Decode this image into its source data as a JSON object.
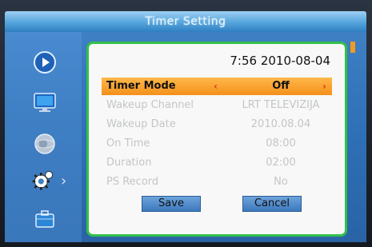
{
  "window": {
    "title": "Timer Setting"
  },
  "clock": "7:56 2010-08-04",
  "nav": [
    {
      "icon": "play-icon"
    },
    {
      "icon": "monitor-icon"
    },
    {
      "icon": "globe-icon"
    },
    {
      "icon": "gear-icon"
    },
    {
      "icon": "briefcase-icon"
    }
  ],
  "rows": [
    {
      "label": "Timer Mode",
      "value": "Off"
    },
    {
      "label": "Wakeup Channel",
      "value": "LRT TELEVIZIJA"
    },
    {
      "label": "Wakeup Date",
      "value": "2010.08.04"
    },
    {
      "label": "On Time",
      "value": "08:00"
    },
    {
      "label": "Duration",
      "value": "02:00"
    },
    {
      "label": "PS Record",
      "value": "No"
    }
  ],
  "buttons": {
    "save": "Save",
    "cancel": "Cancel"
  },
  "colors": {
    "highlight": "#f4901a",
    "frame_border": "#32c04a",
    "title_bar": "#5aa8de",
    "panel": "#3f7fc4"
  }
}
